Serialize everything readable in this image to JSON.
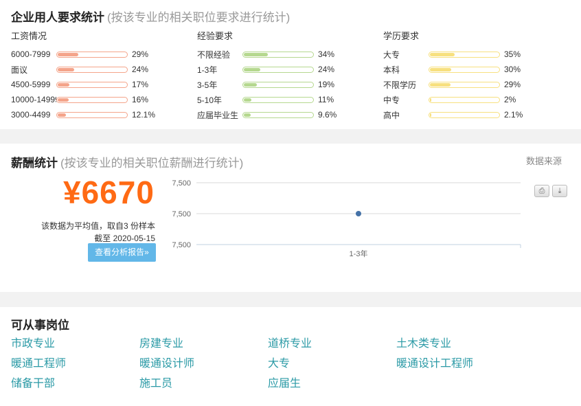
{
  "demand": {
    "title": "企业用人要求统计",
    "subtitle": "(按该专业的相关职位要求进行统计)",
    "columns": [
      {
        "head": "工资情况",
        "color": "#f4a48a",
        "rows": [
          {
            "label": "6000-7999",
            "pct": "29%",
            "value": 29
          },
          {
            "label": "面议",
            "pct": "24%",
            "value": 24
          },
          {
            "label": "4500-5999",
            "pct": "17%",
            "value": 17
          },
          {
            "label": "10000-14999",
            "pct": "16%",
            "value": 16
          },
          {
            "label": "3000-4499",
            "pct": "12.1%",
            "value": 12.1
          }
        ]
      },
      {
        "head": "经验要求",
        "color": "#b5d88f",
        "rows": [
          {
            "label": "不限经验",
            "pct": "34%",
            "value": 34
          },
          {
            "label": "1-3年",
            "pct": "24%",
            "value": 24
          },
          {
            "label": "3-5年",
            "pct": "19%",
            "value": 19
          },
          {
            "label": "5-10年",
            "pct": "11%",
            "value": 11
          },
          {
            "label": "应届毕业生",
            "pct": "9.6%",
            "value": 9.6
          }
        ]
      },
      {
        "head": "学历要求",
        "color": "#f7e07f",
        "rows": [
          {
            "label": "大专",
            "pct": "35%",
            "value": 35
          },
          {
            "label": "本科",
            "pct": "30%",
            "value": 30
          },
          {
            "label": "不限学历",
            "pct": "29%",
            "value": 29
          },
          {
            "label": "中专",
            "pct": "2%",
            "value": 2
          },
          {
            "label": "高中",
            "pct": "2.1%",
            "value": 2.1
          }
        ]
      }
    ]
  },
  "salary": {
    "title": "薪酬统计",
    "subtitle": "(按该专业的相关职位薪酬进行统计)",
    "source_link": "数据来源",
    "average": "¥6670",
    "note_line1": "该数据为平均值，取自3 份样本",
    "note_line2": "截至 2020-05-15",
    "report_button": "查看分析报告»",
    "tools": {
      "print_icon": "print-icon",
      "download_icon": "download-icon"
    }
  },
  "chart_data": {
    "type": "line",
    "categories": [
      "1-3年"
    ],
    "series": [
      {
        "values": [
          7500
        ]
      }
    ],
    "y_tick_labels": [
      "7,500",
      "7,500",
      "7,500"
    ],
    "point_color": "#4572a7",
    "grid": true
  },
  "positions": {
    "title": "可从事岗位",
    "items": [
      "市政专业",
      "房建专业",
      "道桥专业",
      "土木类专业",
      "暖通工程师",
      "暖通设计师",
      "大专",
      "暖通设计工程师",
      "储备干部",
      "施工员",
      "应届生"
    ]
  }
}
